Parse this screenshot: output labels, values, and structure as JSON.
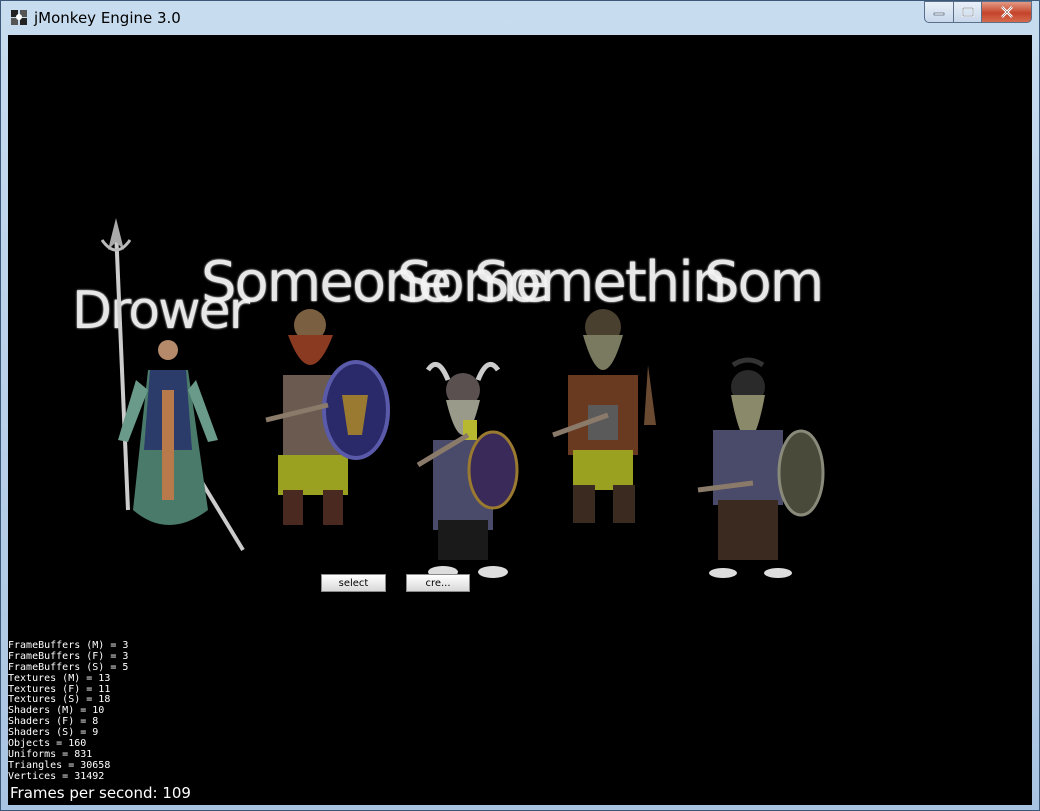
{
  "window": {
    "title": "jMonkey Engine 3.0",
    "controls": [
      "minimize",
      "maximize",
      "close"
    ]
  },
  "characters": [
    {
      "name": "Drower",
      "icon": "elf-mage-figure"
    },
    {
      "name": "Someone",
      "icon": "red-beard-dwarf-figure"
    },
    {
      "name": "Some",
      "icon": "horned-helmet-dwarf-figure"
    },
    {
      "name": "Somethin",
      "icon": "grey-beard-dwarf-figure"
    },
    {
      "name": "Som",
      "icon": "armored-dwarf-figure"
    }
  ],
  "buttons": {
    "select": "select",
    "create": "cre..."
  },
  "stats": [
    "FrameBuffers (M) = 3",
    "FrameBuffers (F) = 3",
    "FrameBuffers (S) = 5",
    "Textures (M) = 13",
    "Textures (F) = 11",
    "Textures (S) = 18",
    "Shaders (M) = 10",
    "Shaders (F) = 8",
    "Shaders (S) = 9",
    "Objects = 160",
    "Uniforms = 831",
    "Triangles = 30658",
    "Vertices = 31492"
  ],
  "fps_text": "Frames per second: 109",
  "colors": {
    "viewport": "#000000",
    "text": "#ffffff",
    "titlebar": "#c8dcef"
  }
}
